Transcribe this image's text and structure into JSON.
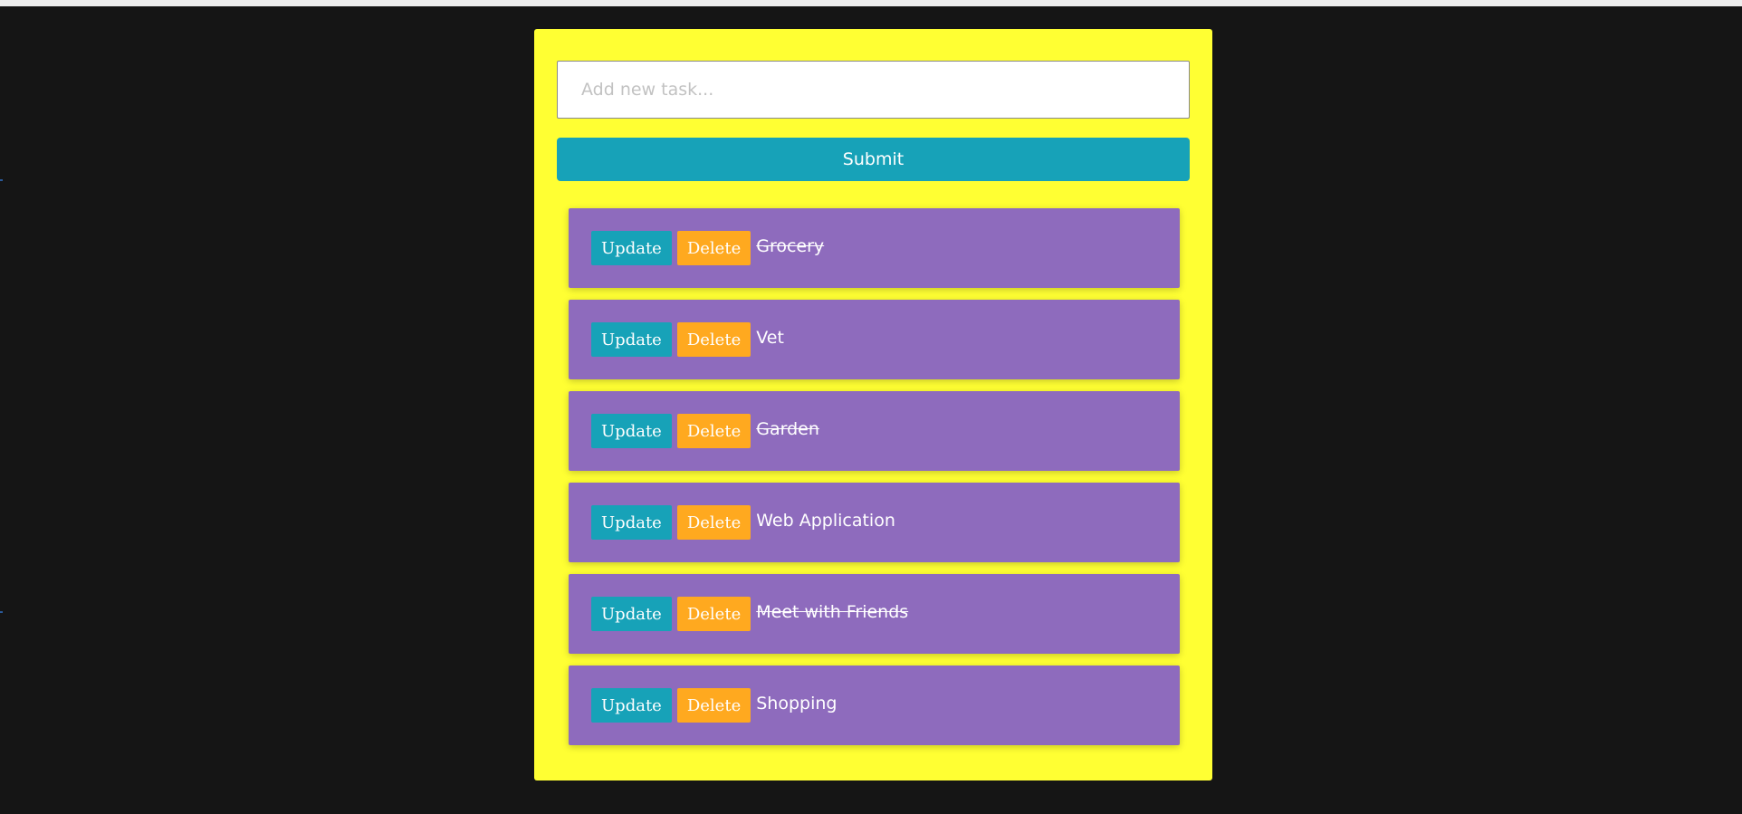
{
  "form": {
    "input_placeholder": "Add new task...",
    "input_value": "",
    "submit_label": "Submit"
  },
  "tasks": [
    {
      "text": "Grocery",
      "completed": true,
      "update_label": "Update",
      "delete_label": "Delete"
    },
    {
      "text": "Vet",
      "completed": false,
      "update_label": "Update",
      "delete_label": "Delete"
    },
    {
      "text": "Garden",
      "completed": true,
      "update_label": "Update",
      "delete_label": "Delete"
    },
    {
      "text": "Web Application",
      "completed": false,
      "update_label": "Update",
      "delete_label": "Delete"
    },
    {
      "text": "Meet with Friends",
      "completed": true,
      "update_label": "Update",
      "delete_label": "Delete"
    },
    {
      "text": "Shopping",
      "completed": false,
      "update_label": "Update",
      "delete_label": "Delete"
    }
  ],
  "colors": {
    "page_background": "#151515",
    "panel_background": "#ffff33",
    "task_background": "#8e6bbd",
    "update_button": "#17a2b8",
    "delete_button": "#ffa91f",
    "submit_button": "#17a2b8"
  }
}
